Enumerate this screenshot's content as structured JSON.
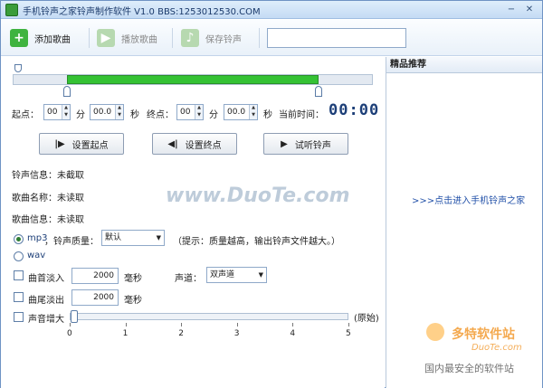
{
  "window": {
    "title": "手机铃声之家铃声制作软件   V1.0   BBS:1253012530.COM",
    "min": "−",
    "close": "✕"
  },
  "toolbar": {
    "add": "添加歌曲",
    "play": "播放歌曲",
    "save": "保存铃声",
    "search_value": ""
  },
  "timeline": {
    "start_fraction": 0.15,
    "end_fraction": 0.85
  },
  "points": {
    "start_label": "起点：",
    "start_min": "00",
    "min_unit": "分",
    "start_sec": "00.0",
    "sec_unit": "秒",
    "end_label": "终点：",
    "end_min": "00",
    "end_sec": "00.0",
    "current_label": "当前时间：",
    "current_time": "00:00"
  },
  "buttons": {
    "set_start": "设置起点",
    "set_end": "设置终点",
    "preview": "试听铃声"
  },
  "info": {
    "ringtone_info": "铃声信息：未截取",
    "song_name": "歌曲名称：未读取",
    "song_info": "歌曲信息：未读取"
  },
  "format": {
    "mp3": "mp3",
    "quality_label": "，铃声质量：",
    "quality_value": "默认",
    "tip": "（提示：质量越高，输出铃声文件越大。）",
    "wav": "wav"
  },
  "effects": {
    "fade_in": "曲首淡入",
    "fade_in_value": "2000",
    "ms": "毫秒",
    "channel_label": "声道：",
    "channel_value": "双声道",
    "fade_out": "曲尾淡出",
    "fade_out_value": "2000",
    "boost": "声音增大",
    "boost_value": 0,
    "boost_max": 5,
    "original": "(原始)",
    "ticks": [
      "0",
      "1",
      "2",
      "3",
      "4",
      "5"
    ]
  },
  "right": {
    "header": "精品推荐",
    "link": ">>>点击进入手机铃声之家"
  },
  "watermarks": {
    "main": "www.DuoTe.com",
    "logo": "多特软件站",
    "logo_url": "DuoTe.com",
    "logo_sub": "国内最安全的软件站"
  },
  "colors": {
    "green": "#3fb33f",
    "accent": "#1d3f78"
  }
}
